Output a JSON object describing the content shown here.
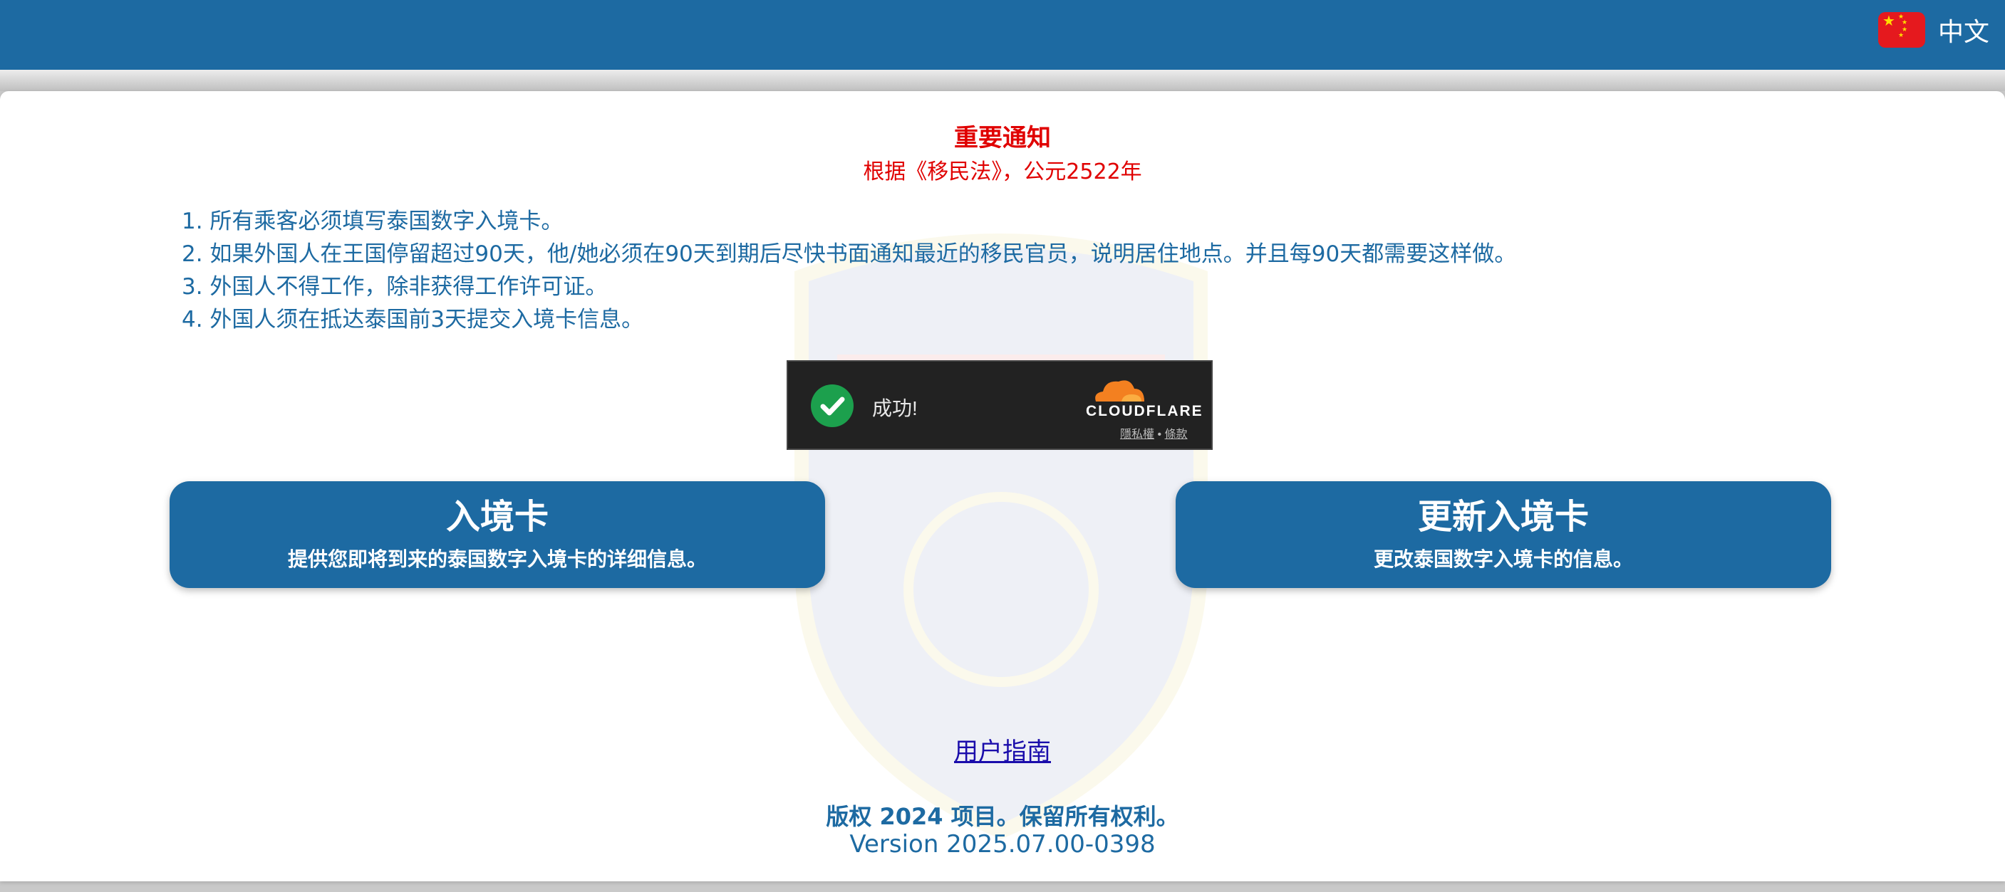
{
  "header": {
    "language_label": "中文",
    "flag": "china-flag-icon",
    "bar_color": "#1d6aa2"
  },
  "notice": {
    "title": "重要通知",
    "subtitle": "根据《移民法》，公元2522年",
    "rules": [
      "1. 所有乘客必须填写泰国数字入境卡。",
      "2. 如果外国人在王国停留超过90天，他/她必须在90天到期后尽快书面通知最近的移民官员，说明居住地点。并且每90天都需要这样做。",
      "3. 外国人不得工作，除非获得工作许可证。",
      "4. 外国人须在抵达泰国前3天提交入境卡信息。"
    ],
    "color": "#e00000"
  },
  "captcha": {
    "status": "成功!",
    "brand": "CLOUDFLARE",
    "privacy_link": "隱私權",
    "separator": "•",
    "terms_link": "條款"
  },
  "actions": {
    "arrival_card": {
      "title": "入境卡",
      "description": "提供您即将到来的泰国数字入境卡的详细信息。"
    },
    "update_card": {
      "title": "更新入境卡",
      "description": "更改泰国数字入境卡的信息。"
    }
  },
  "footer": {
    "guide_link": "用户指南",
    "copyright": "版权 2024 项目。保留所有权利。",
    "version": "Version 2025.07.00-0398"
  }
}
